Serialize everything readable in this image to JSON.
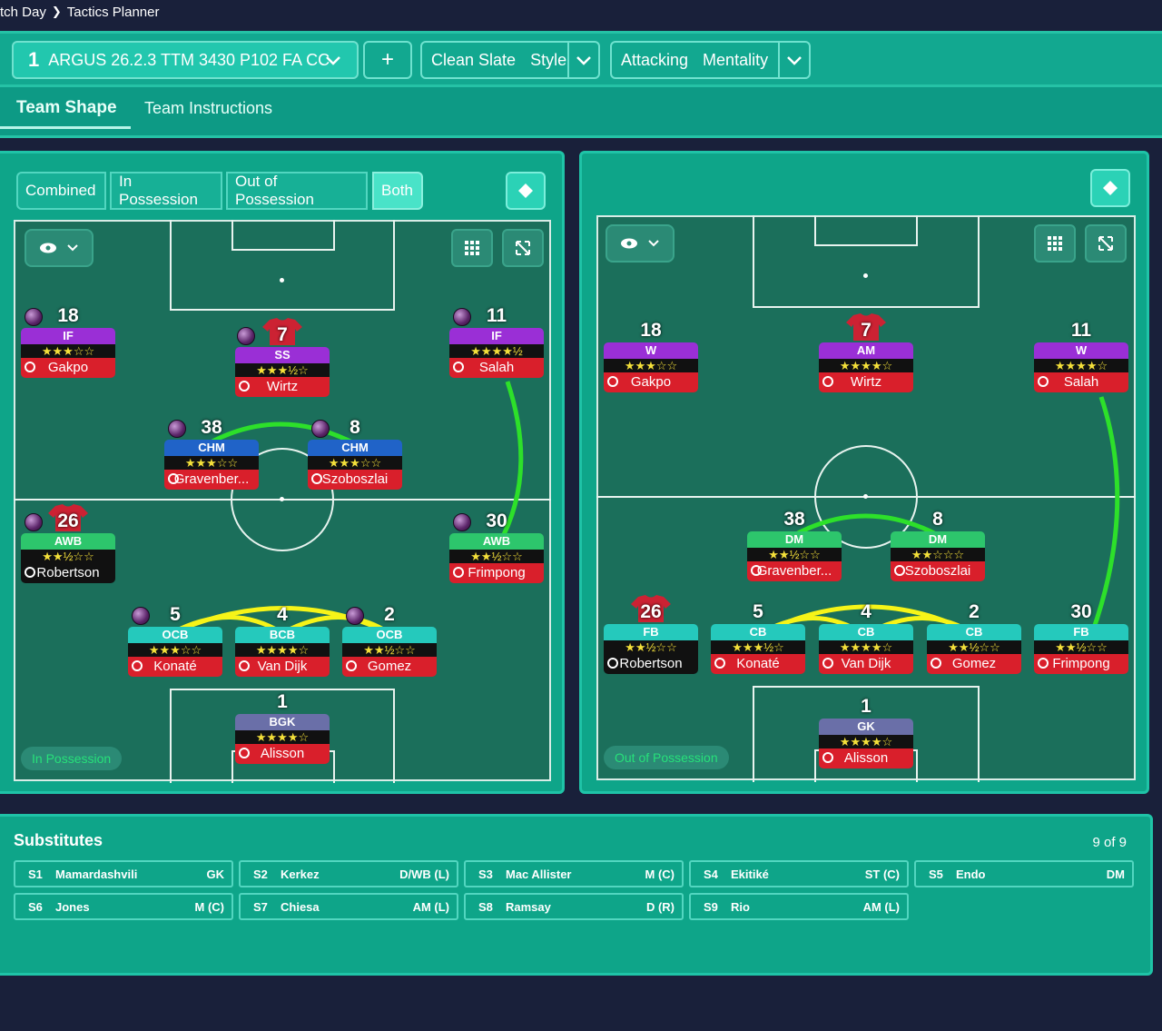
{
  "breadcrumb": {
    "parent": "tch Day",
    "current": "Tactics Planner"
  },
  "tactic": {
    "slot": "1",
    "name": "ARGUS 26.2.3 TTM  3430 P102 FA CC",
    "add": "+",
    "style_value": "Clean Slate",
    "style_label": "Style",
    "mentality_value": "Attacking",
    "mentality_label": "Mentality"
  },
  "tabs": {
    "team_shape": "Team Shape",
    "team_instructions": "Team Instructions"
  },
  "phase_filter": {
    "combined": "Combined",
    "in_possession": "In Possession",
    "out_of_possession": "Out of Possession",
    "both": "Both"
  },
  "left_pitch": {
    "label": "In Possession"
  },
  "right_pitch": {
    "label": "Out of Possession"
  },
  "colors": {
    "teal": "#0ea589",
    "link_green": "#2de02a",
    "link_yellow": "#f6f418",
    "star": "#f4e03a"
  },
  "left_players": [
    {
      "num": "18",
      "role": "IF",
      "stars": "★★★☆☆",
      "name": "Gakpo"
    },
    {
      "num": "7",
      "role": "SS",
      "stars": "★★★½☆",
      "name": "Wirtz"
    },
    {
      "num": "11",
      "role": "IF",
      "stars": "★★★★½",
      "name": "Salah"
    },
    {
      "num": "38",
      "role": "CHM",
      "stars": "★★★☆☆",
      "name": "Gravenber..."
    },
    {
      "num": "8",
      "role": "CHM",
      "stars": "★★★☆☆",
      "name": "Szoboszlai"
    },
    {
      "num": "26",
      "role": "AWB",
      "stars": "★★½☆☆",
      "name": "Robertson"
    },
    {
      "num": "30",
      "role": "AWB",
      "stars": "★★½☆☆",
      "name": "Frimpong"
    },
    {
      "num": "5",
      "role": "OCB",
      "stars": "★★★☆☆",
      "name": "Konaté"
    },
    {
      "num": "4",
      "role": "BCB",
      "stars": "★★★★☆",
      "name": "Van Dijk"
    },
    {
      "num": "2",
      "role": "OCB",
      "stars": "★★½☆☆",
      "name": "Gomez"
    },
    {
      "num": "1",
      "role": "BGK",
      "stars": "★★★★☆",
      "name": "Alisson"
    }
  ],
  "right_players": [
    {
      "num": "18",
      "role": "W",
      "stars": "★★★☆☆",
      "name": "Gakpo"
    },
    {
      "num": "7",
      "role": "AM",
      "stars": "★★★★☆",
      "name": "Wirtz"
    },
    {
      "num": "11",
      "role": "W",
      "stars": "★★★★☆",
      "name": "Salah"
    },
    {
      "num": "38",
      "role": "DM",
      "stars": "★★½☆☆",
      "name": "Gravenber..."
    },
    {
      "num": "8",
      "role": "DM",
      "stars": "★★☆☆☆",
      "name": "Szoboszlai"
    },
    {
      "num": "26",
      "role": "FB",
      "stars": "★★½☆☆",
      "name": "Robertson"
    },
    {
      "num": "5",
      "role": "CB",
      "stars": "★★★½☆",
      "name": "Konaté"
    },
    {
      "num": "4",
      "role": "CB",
      "stars": "★★★★☆",
      "name": "Van Dijk"
    },
    {
      "num": "2",
      "role": "CB",
      "stars": "★★½☆☆",
      "name": "Gomez"
    },
    {
      "num": "30",
      "role": "FB",
      "stars": "★★½☆☆",
      "name": "Frimpong"
    },
    {
      "num": "1",
      "role": "GK",
      "stars": "★★★★☆",
      "name": "Alisson"
    }
  ],
  "substitutes": {
    "title": "Substitutes",
    "count": "9 of 9",
    "items": [
      {
        "id": "S1",
        "name": "Mamardashvili",
        "pos": "GK"
      },
      {
        "id": "S2",
        "name": "Kerkez",
        "pos": "D/WB (L)"
      },
      {
        "id": "S3",
        "name": "Mac Allister",
        "pos": "M (C)"
      },
      {
        "id": "S4",
        "name": "Ekitiké",
        "pos": "ST (C)"
      },
      {
        "id": "S5",
        "name": "Endo",
        "pos": "DM"
      },
      {
        "id": "S6",
        "name": "Jones",
        "pos": "M (C)"
      },
      {
        "id": "S7",
        "name": "Chiesa",
        "pos": "AM (L)"
      },
      {
        "id": "S8",
        "name": "Ramsay",
        "pos": "D (R)"
      },
      {
        "id": "S9",
        "name": "Rio",
        "pos": "AM (L)"
      }
    ]
  }
}
